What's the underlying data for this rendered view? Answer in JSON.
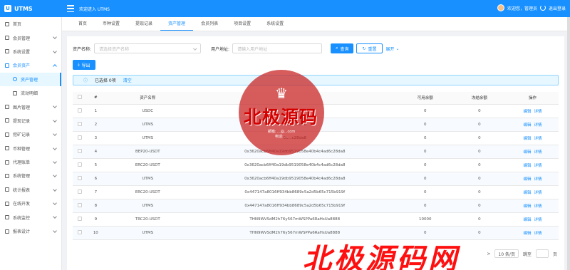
{
  "app": {
    "name": "UTMS",
    "welcome": "欢迎进入 UTMS",
    "user_greeting": "欢迎您，管理员",
    "logout": "退出登录"
  },
  "sidebar": {
    "items": [
      {
        "label": "首页",
        "icon": "home-icon"
      },
      {
        "label": "会员管理",
        "icon": "user-icon"
      },
      {
        "label": "系统设置",
        "icon": "settings-icon"
      },
      {
        "label": "会员资产",
        "icon": "asset-icon"
      },
      {
        "label": "资产管理",
        "icon": "circle-icon"
      },
      {
        "label": "流动明细",
        "icon": "list-icon"
      },
      {
        "label": "图片管理",
        "icon": "image-icon"
      },
      {
        "label": "提现记录",
        "icon": "withdraw-icon"
      },
      {
        "label": "挖矿记录",
        "icon": "mining-icon"
      },
      {
        "label": "币种管理",
        "icon": "coin-icon"
      },
      {
        "label": "代理账单",
        "icon": "agent-icon"
      },
      {
        "label": "系统管理",
        "icon": "system-icon"
      },
      {
        "label": "统计报表",
        "icon": "report-icon"
      },
      {
        "label": "在线开发",
        "icon": "code-icon"
      },
      {
        "label": "系统监控",
        "icon": "monitor-icon"
      },
      {
        "label": "报表设计",
        "icon": "design-icon"
      }
    ]
  },
  "tabs": [
    "首页",
    "币种设置",
    "提现记录",
    "资产管理",
    "会员列表",
    "项目设置",
    "系统设置"
  ],
  "search": {
    "asset_label": "资产名称:",
    "asset_placeholder": "请选择资产名称",
    "user_label": "用户地址:",
    "user_placeholder": "请输入用户地址",
    "query": "查询",
    "reset": "重置",
    "expand": "展开"
  },
  "export_label": "导出",
  "selection": {
    "text": "已选择 0项",
    "clear": "清空"
  },
  "table": {
    "headers": [
      "#",
      "资产名称",
      "",
      "可用余额",
      "冻结余额",
      "操作"
    ],
    "rows": [
      {
        "no": "1",
        "asset": "USDC",
        "address": "0x...c28da8",
        "avail": "0",
        "frozen": "0"
      },
      {
        "no": "2",
        "asset": "UTMS",
        "address": "0x...c28da8",
        "avail": "0",
        "frozen": "0"
      },
      {
        "no": "3",
        "asset": "UTMS",
        "address": "0x...c28da8",
        "avail": "0",
        "frozen": "0"
      },
      {
        "no": "4",
        "asset": "BEP20-USDT",
        "address": "0x3620acb6ff40a19db9519058e40b4c4ad6c28da8",
        "avail": "0",
        "frozen": "0"
      },
      {
        "no": "5",
        "asset": "ERC20-USDT",
        "address": "0x3620acb6ff40a19db9519058e40b4c4ad6c28da8",
        "avail": "0",
        "frozen": "0"
      },
      {
        "no": "6",
        "asset": "UTMS",
        "address": "0x3620acb6ff40a19db9519058e40b4c4ad6c28da8",
        "avail": "0",
        "frozen": "0"
      },
      {
        "no": "7",
        "asset": "ERC20-USDT",
        "address": "0x447147a8016ff934bb8689c5a2d5b65c715b919f",
        "avail": "0",
        "frozen": "0"
      },
      {
        "no": "8",
        "asset": "UTMS",
        "address": "0x447147a8016ff934bb8689c5a2d5b65c715b919f",
        "avail": "0",
        "frozen": "0"
      },
      {
        "no": "9",
        "asset": "TRC20-USDT",
        "address": "THN9WVSdM2h76y567mWSPPa6RaHsUa8888",
        "avail": "10000",
        "frozen": "0"
      },
      {
        "no": "10",
        "asset": "UTMS",
        "address": "THN9WVSdM2h76y567mWSPPa6RaHsUa8888",
        "avail": "0",
        "frozen": "0"
      }
    ],
    "edit": "编辑",
    "detail": "详情"
  },
  "pagination": {
    "next": ">",
    "page_size": "10 条/页",
    "goto": "跳至",
    "page": "页"
  },
  "watermark": {
    "seal_line1": "邮箱: ...@...com",
    "seal_line2": "电话: ...",
    "title": "北极源码",
    "bottom": "北极源码网"
  }
}
